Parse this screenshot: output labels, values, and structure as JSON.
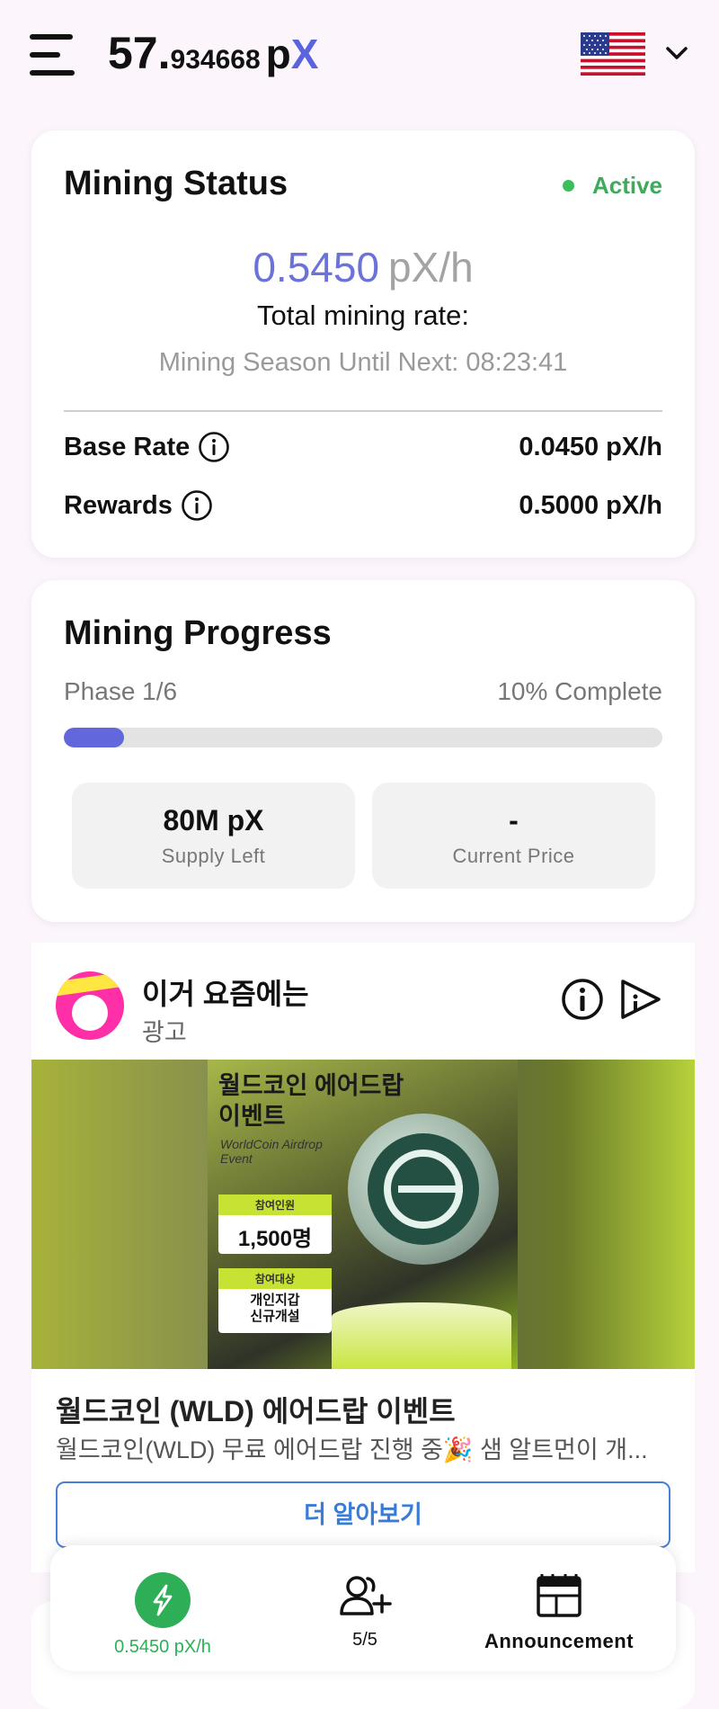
{
  "header": {
    "balance_int": "57.",
    "balance_dec": "934668",
    "balance_unit_p": "p",
    "balance_unit_x": "X",
    "language_flag": "us-flag-icon"
  },
  "mining_status": {
    "title": "Mining Status",
    "badge": "Active",
    "rate_value": "0.5450",
    "rate_unit": "pX/h",
    "rate_label": "Total mining rate:",
    "season_text": "Mining Season Until Next: 08:23:41",
    "rows": [
      {
        "label": "Base Rate",
        "value": "0.0450 pX/h"
      },
      {
        "label": "Rewards",
        "value": "0.5000 pX/h"
      }
    ]
  },
  "mining_progress": {
    "title": "Mining Progress",
    "phase": "Phase 1/6",
    "complete": "10% Complete",
    "progress_fraction": 0.1,
    "stats": [
      {
        "value": "80M pX",
        "label": "Supply Left"
      },
      {
        "value": "-",
        "label": "Current Price"
      }
    ]
  },
  "ad": {
    "advertiser": "이거 요즘에는",
    "sponsored_label": "광고",
    "image_heading": [
      "월드코인 에어드랍",
      "이벤트"
    ],
    "image_english": [
      "WorldCoin Airdrop",
      "Event"
    ],
    "box1_title": "참여인원",
    "box1_value": "1,500명",
    "box2_title": "참여대상",
    "box2_value": [
      "개인지갑",
      "신규개설"
    ],
    "headline": "월드코인 (WLD) 에어드랍 이벤트",
    "body": "월드코인(WLD) 무료 에어드랍 진행 중🎉 샘 알트먼이 개...",
    "cta": "더 알아보기"
  },
  "bottom_nav": [
    {
      "label": "0.5450 pX/h",
      "icon": "lightning-icon"
    },
    {
      "label": "5/5",
      "icon": "add-user-icon"
    },
    {
      "label": "Announcement",
      "icon": "newspaper-icon"
    }
  ],
  "colors": {
    "accent": "#5b63dd",
    "active_green": "#3daa5c",
    "progress_fill": "#6268db",
    "nav_green": "#2fae58"
  }
}
